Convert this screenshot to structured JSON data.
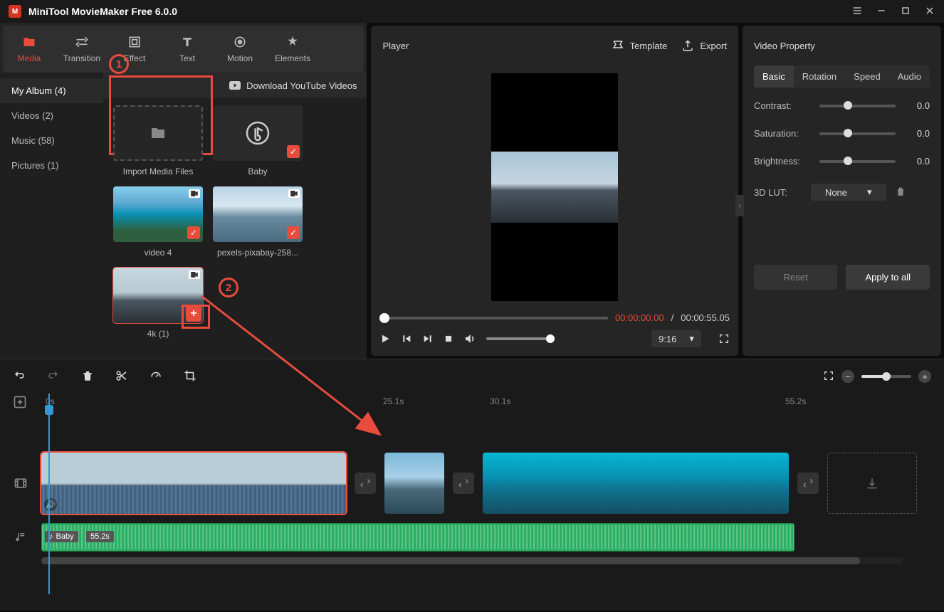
{
  "app": {
    "title": "MiniTool MovieMaker Free 6.0.0"
  },
  "toolbar": [
    {
      "label": "Media",
      "name": "media-tab",
      "active": true
    },
    {
      "label": "Transition",
      "name": "transition-tab"
    },
    {
      "label": "Effect",
      "name": "effect-tab"
    },
    {
      "label": "Text",
      "name": "text-tab"
    },
    {
      "label": "Motion",
      "name": "motion-tab"
    },
    {
      "label": "Elements",
      "name": "elements-tab"
    }
  ],
  "sidebar": {
    "items": [
      {
        "label": "My Album (4)",
        "active": true
      },
      {
        "label": "Videos (2)"
      },
      {
        "label": "Music (58)"
      },
      {
        "label": "Pictures (1)"
      }
    ]
  },
  "media": {
    "download_label": "Download YouTube Videos",
    "import_label": "Import Media Files",
    "items": [
      {
        "label": "Baby",
        "type": "audio"
      },
      {
        "label": "video 4",
        "type": "video"
      },
      {
        "label": "pexels-pixabay-258...",
        "type": "video"
      },
      {
        "label": "4k (1)",
        "type": "video",
        "selected": true
      }
    ]
  },
  "annotations": {
    "step1": "1",
    "step2": "2"
  },
  "player": {
    "title": "Player",
    "template_label": "Template",
    "export_label": "Export",
    "time_current": "00:00:00.00",
    "time_separator": "/",
    "time_duration": "00:00:55.05",
    "aspect": "9:16"
  },
  "property": {
    "title": "Video Property",
    "tabs": [
      {
        "label": "Basic",
        "active": true
      },
      {
        "label": "Rotation"
      },
      {
        "label": "Speed"
      },
      {
        "label": "Audio"
      }
    ],
    "contrast": {
      "label": "Contrast:",
      "value": "0.0"
    },
    "saturation": {
      "label": "Saturation:",
      "value": "0.0"
    },
    "brightness": {
      "label": "Brightness:",
      "value": "0.0"
    },
    "lut": {
      "label": "3D LUT:",
      "value": "None"
    },
    "reset": "Reset",
    "apply": "Apply to all"
  },
  "timeline": {
    "marks": [
      {
        "label": "0s",
        "pos": 0
      },
      {
        "label": "25.1s",
        "pos": 480
      },
      {
        "label": "30.1s",
        "pos": 630
      },
      {
        "label": "55.2s",
        "pos": 1045
      }
    ],
    "audio": {
      "name": "Baby",
      "duration": "55.2s"
    }
  }
}
